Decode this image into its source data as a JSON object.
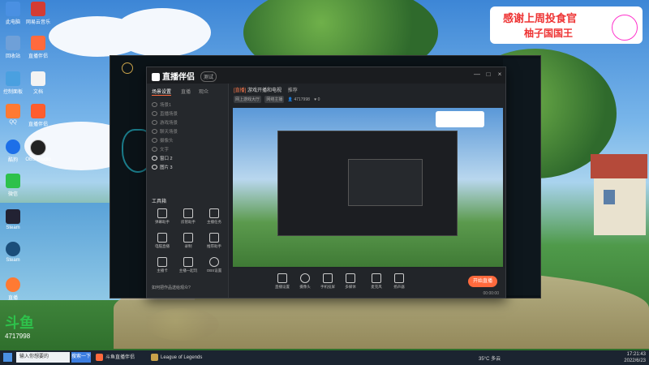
{
  "banner": {
    "line1": "感谢上周投食官",
    "line2": "柚子国国王"
  },
  "desktop_icons": [
    {
      "label": "此电脑",
      "color": "#4a90e2"
    },
    {
      "label": "网易云音乐",
      "color": "#d43c33"
    },
    {
      "label": "回收站",
      "color": "#6fa0d8"
    },
    {
      "label": "直播伴侣",
      "color": "#ff6a3d"
    },
    {
      "label": "控制面板",
      "color": "#4aa0e0"
    },
    {
      "label": "文档",
      "color": "#f3f3f3"
    },
    {
      "label": "QQ",
      "color": "#ff7a33"
    },
    {
      "label": "直播伴侣",
      "color": "#ff5d2e"
    },
    {
      "label": "酷狗",
      "color": "#1d6fe8"
    },
    {
      "label": "OBS Studio",
      "color": "#222"
    },
    {
      "label": "微信",
      "color": "#2ec14b"
    },
    {
      "label": "Steam",
      "color": "#223"
    },
    {
      "label": "Steam",
      "color": "#1b4e7a"
    },
    {
      "label": "直播",
      "color": "#ff7a33"
    }
  ],
  "taskbar_overlay": {
    "brand": "斗鱼",
    "count": "4717998"
  },
  "app": {
    "title": "直播伴侣",
    "badge": "测试",
    "window_buttons": [
      "—",
      "□",
      "×"
    ],
    "tabs": [
      "场景设置",
      "直播",
      "观众"
    ],
    "scenes": [
      "场景1",
      "直播场景",
      "游戏场景",
      "聊天场景",
      "摄像头",
      "文字",
      "窗口 2",
      "图片 3"
    ],
    "tools_title": "工具箱",
    "tools": [
      "弹幕助手",
      "房管助手",
      "主播任务",
      "电脑直播",
      "录制",
      "推荐助手",
      "主播卡",
      "主播一起玩",
      "OBS设置",
      "点歌",
      "连麦",
      "聊天"
    ],
    "hint": "如何把作品送给观众?"
  },
  "stream": {
    "header_tag": "[直播]",
    "header_title": "游戏开播和电视",
    "header_tail": "推荐",
    "sub_pills": [
      "网上游戏大厅",
      "网络主播"
    ],
    "viewers": "4717998",
    "likes": "0",
    "bottom_tools": [
      "直播设置",
      "摄像头",
      "手机投屏",
      "多媒体",
      "麦克风",
      "扬声器"
    ],
    "go_live": "开始直播",
    "timer": "00:00:00"
  },
  "taskbar": {
    "search_placeholder": "输入你想要的",
    "search_button": "搜索一下",
    "items": [
      {
        "label": "斗鱼直播伴侣",
        "color": "#ff6a3d"
      },
      {
        "label": "League of Legends",
        "color": "#c8a24a"
      }
    ],
    "weather": "35°C 多云",
    "time": "17:21:43",
    "date": "2022/6/23"
  }
}
